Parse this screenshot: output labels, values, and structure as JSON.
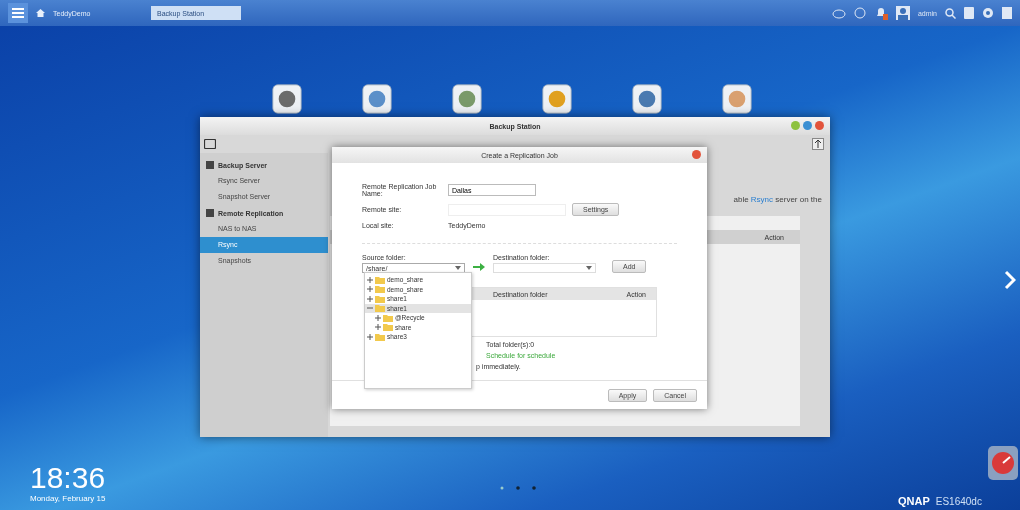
{
  "taskbar": {
    "home_label": "TeddyDemo",
    "open_app": "Backup Station",
    "user": "admin"
  },
  "window": {
    "title": "Backup Station",
    "sidebar": [
      {
        "label": "Backup Server",
        "children": [
          {
            "label": "Rsync Server",
            "selected": false
          },
          {
            "label": "Snapshot Server",
            "selected": false
          }
        ]
      },
      {
        "label": "Remote Replication",
        "children": [
          {
            "label": "NAS to NAS",
            "selected": false
          },
          {
            "label": "Rsync",
            "selected": true
          },
          {
            "label": "Snapshots",
            "selected": false
          }
        ]
      }
    ],
    "intro": {
      "before": "able",
      "link": "Rsync",
      "after": "server on the"
    },
    "table_column": "Action"
  },
  "dialog": {
    "title": "Create a Replication Job",
    "job_name_label": "Remote Replication Job Name:",
    "job_name": "Dallas",
    "remote_site_label": "Remote site:",
    "settings_button": "Settings",
    "local_site_label": "Local site:",
    "local_site": "TeddyDemo",
    "source_label": "Source folder:",
    "source_value": "/share/",
    "destination_label": "Destination folder:",
    "add_button": "Add",
    "columns": [
      "Destination folder",
      "Action"
    ],
    "total": "Total folder(s):0",
    "schedule": "Schedule for schedule",
    "immediately": "p immediately.",
    "buttons": [
      "Apply",
      "Cancel"
    ],
    "tree": [
      {
        "label": "demo_share",
        "expanded": false,
        "selected": false
      },
      {
        "label": "demo_share",
        "expanded": false,
        "selected": false
      },
      {
        "label": "share1",
        "expanded": false,
        "selected": false
      },
      {
        "label": "share1",
        "expanded": true,
        "selected": true,
        "children": [
          {
            "label": "@Recycle",
            "expanded": false,
            "selected": false
          },
          {
            "label": "share",
            "expanded": false,
            "selected": false
          }
        ]
      },
      {
        "label": "share3",
        "expanded": false,
        "selected": false
      }
    ]
  },
  "clock": {
    "time": "18:36",
    "date": "Monday, February 15"
  },
  "brand": {
    "logo": "QNAP",
    "model": "ES1640dc"
  }
}
